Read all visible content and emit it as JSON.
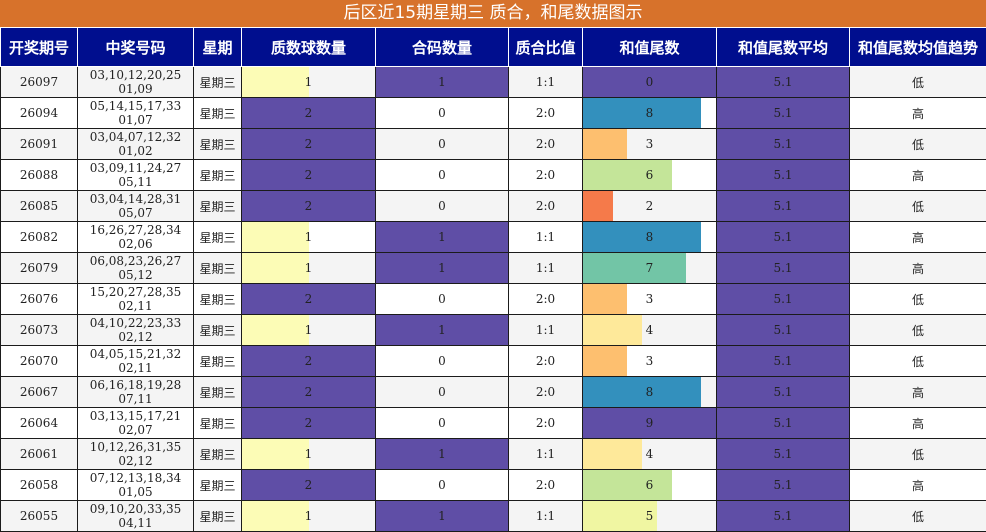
{
  "title": "后区近15期星期三 质合，和尾数据图示",
  "headers": [
    "开奖期号",
    "中奖号码",
    "星期",
    "质数球数量",
    "合码数量",
    "质合比值",
    "和值尾数",
    "和值尾数平均",
    "和值尾数均值趋势"
  ],
  "colors": {
    "title_bg": "#d7722b",
    "header_bg": "#000e8e",
    "purple": "#5f4ea6",
    "prime_one": "#fcfcb6",
    "tail_colors": {
      "0": "#5f4ea6",
      "2": "#f57a4a",
      "3": "#fdbf6f",
      "4": "#fee99a",
      "5": "#f0f6a2",
      "6": "#c4e599",
      "7": "#72c5a6",
      "8": "#3390bd",
      "9": "#5f4ea6"
    }
  },
  "chart_data": {
    "type": "table",
    "max_tail": 9,
    "rows": [
      {
        "issue": "26097",
        "numbers": "03,10,12,20,25 01,09",
        "weekday": "星期三",
        "prime_count": 1,
        "composite_count": 1,
        "ratio": "1:1",
        "tail": 0,
        "avg": "5.1",
        "trend": "低"
      },
      {
        "issue": "26094",
        "numbers": "05,14,15,17,33 01,07",
        "weekday": "星期三",
        "prime_count": 2,
        "composite_count": 0,
        "ratio": "2:0",
        "tail": 8,
        "avg": "5.1",
        "trend": "高"
      },
      {
        "issue": "26091",
        "numbers": "03,04,07,12,32 01,02",
        "weekday": "星期三",
        "prime_count": 2,
        "composite_count": 0,
        "ratio": "2:0",
        "tail": 3,
        "avg": "5.1",
        "trend": "低"
      },
      {
        "issue": "26088",
        "numbers": "03,09,11,24,27 05,11",
        "weekday": "星期三",
        "prime_count": 2,
        "composite_count": 0,
        "ratio": "2:0",
        "tail": 6,
        "avg": "5.1",
        "trend": "高"
      },
      {
        "issue": "26085",
        "numbers": "03,04,14,28,31 05,07",
        "weekday": "星期三",
        "prime_count": 2,
        "composite_count": 0,
        "ratio": "2:0",
        "tail": 2,
        "avg": "5.1",
        "trend": "低"
      },
      {
        "issue": "26082",
        "numbers": "16,26,27,28,34 02,06",
        "weekday": "星期三",
        "prime_count": 1,
        "composite_count": 1,
        "ratio": "1:1",
        "tail": 8,
        "avg": "5.1",
        "trend": "高"
      },
      {
        "issue": "26079",
        "numbers": "06,08,23,26,27 05,12",
        "weekday": "星期三",
        "prime_count": 1,
        "composite_count": 1,
        "ratio": "1:1",
        "tail": 7,
        "avg": "5.1",
        "trend": "高"
      },
      {
        "issue": "26076",
        "numbers": "15,20,27,28,35 02,11",
        "weekday": "星期三",
        "prime_count": 2,
        "composite_count": 0,
        "ratio": "2:0",
        "tail": 3,
        "avg": "5.1",
        "trend": "低"
      },
      {
        "issue": "26073",
        "numbers": "04,10,22,23,33 02,12",
        "weekday": "星期三",
        "prime_count": 1,
        "composite_count": 1,
        "ratio": "1:1",
        "tail": 4,
        "avg": "5.1",
        "trend": "低"
      },
      {
        "issue": "26070",
        "numbers": "04,05,15,21,32 02,11",
        "weekday": "星期三",
        "prime_count": 2,
        "composite_count": 0,
        "ratio": "2:0",
        "tail": 3,
        "avg": "5.1",
        "trend": "低"
      },
      {
        "issue": "26067",
        "numbers": "06,16,18,19,28 07,11",
        "weekday": "星期三",
        "prime_count": 2,
        "composite_count": 0,
        "ratio": "2:0",
        "tail": 8,
        "avg": "5.1",
        "trend": "高"
      },
      {
        "issue": "26064",
        "numbers": "03,13,15,17,21 02,07",
        "weekday": "星期三",
        "prime_count": 2,
        "composite_count": 0,
        "ratio": "2:0",
        "tail": 9,
        "avg": "5.1",
        "trend": "高"
      },
      {
        "issue": "26061",
        "numbers": "10,12,26,31,35 02,12",
        "weekday": "星期三",
        "prime_count": 1,
        "composite_count": 1,
        "ratio": "1:1",
        "tail": 4,
        "avg": "5.1",
        "trend": "低"
      },
      {
        "issue": "26058",
        "numbers": "07,12,13,18,34 01,05",
        "weekday": "星期三",
        "prime_count": 2,
        "composite_count": 0,
        "ratio": "2:0",
        "tail": 6,
        "avg": "5.1",
        "trend": "高"
      },
      {
        "issue": "26055",
        "numbers": "09,10,20,33,35 04,11",
        "weekday": "星期三",
        "prime_count": 1,
        "composite_count": 1,
        "ratio": "1:1",
        "tail": 5,
        "avg": "5.1",
        "trend": "低"
      }
    ]
  }
}
